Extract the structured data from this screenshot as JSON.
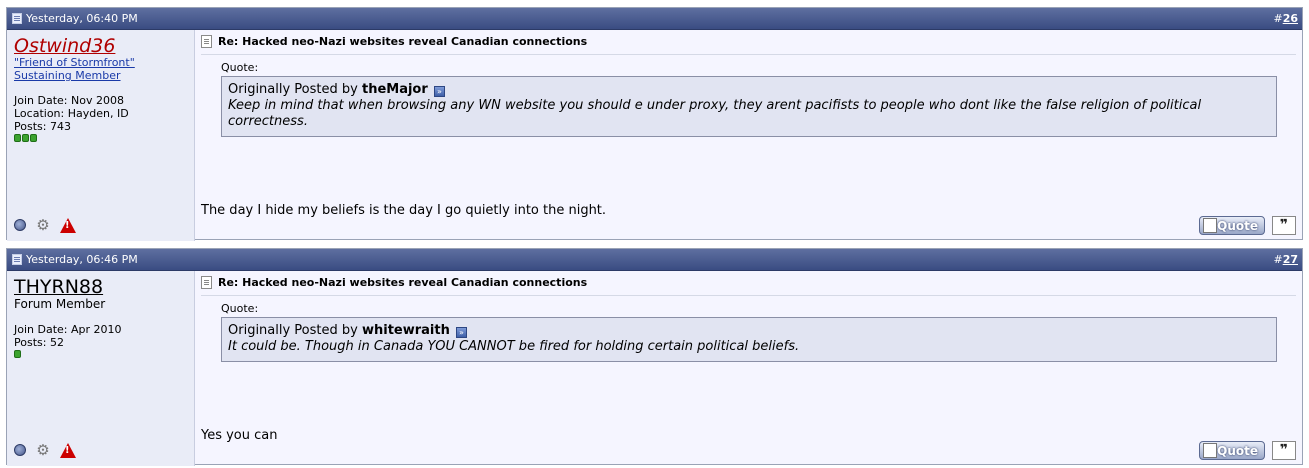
{
  "posts": [
    {
      "date": "Yesterday, 06:40 PM",
      "number": "26",
      "username": "Ostwind36",
      "user_title_line1": "\"Friend of Stormfront\"",
      "user_title_line2": "Sustaining Member",
      "join_date": "Join Date: Nov 2008",
      "location": "Location: Hayden, ID",
      "posts": "Posts: 743",
      "title": "Re: Hacked neo-Nazi websites reveal Canadian connections",
      "quote_label": "Quote:",
      "quote_prefix": "Originally Posted by",
      "quote_author": "theMajor",
      "quote_text": "Keep in mind that when browsing any WN website you should e under proxy, they arent pacifists to people who dont like the false religion of political correctness.",
      "message": "The day I hide my beliefs is the day I go quietly into the night.",
      "quote_button": "Quote"
    },
    {
      "date": "Yesterday, 06:46 PM",
      "number": "27",
      "username": "THYRN88",
      "user_title": "Forum Member",
      "join_date": "Join Date: Apr 2010",
      "posts": "Posts: 52",
      "title": "Re: Hacked neo-Nazi websites reveal Canadian connections",
      "quote_label": "Quote:",
      "quote_prefix": "Originally Posted by",
      "quote_author": "whitewraith",
      "quote_text": "It could be. Though in Canada YOU CANNOT be fired for holding certain political beliefs.",
      "message": "Yes you can",
      "quote_button": "Quote"
    }
  ],
  "icons": {
    "status": "online-status-icon",
    "address_book": "address-book-icon",
    "report": "report-post-icon",
    "view_post": "view-post-icon",
    "multiquote": "multiquote-icon"
  },
  "colors": {
    "header_bar": "#3a4c82",
    "username_red": "#b00000",
    "link_blue": "#1a3aa8",
    "reputation_green": "#3ca32f"
  },
  "reputation": [
    {
      "pips": 3
    },
    {
      "pips": 1
    }
  ]
}
